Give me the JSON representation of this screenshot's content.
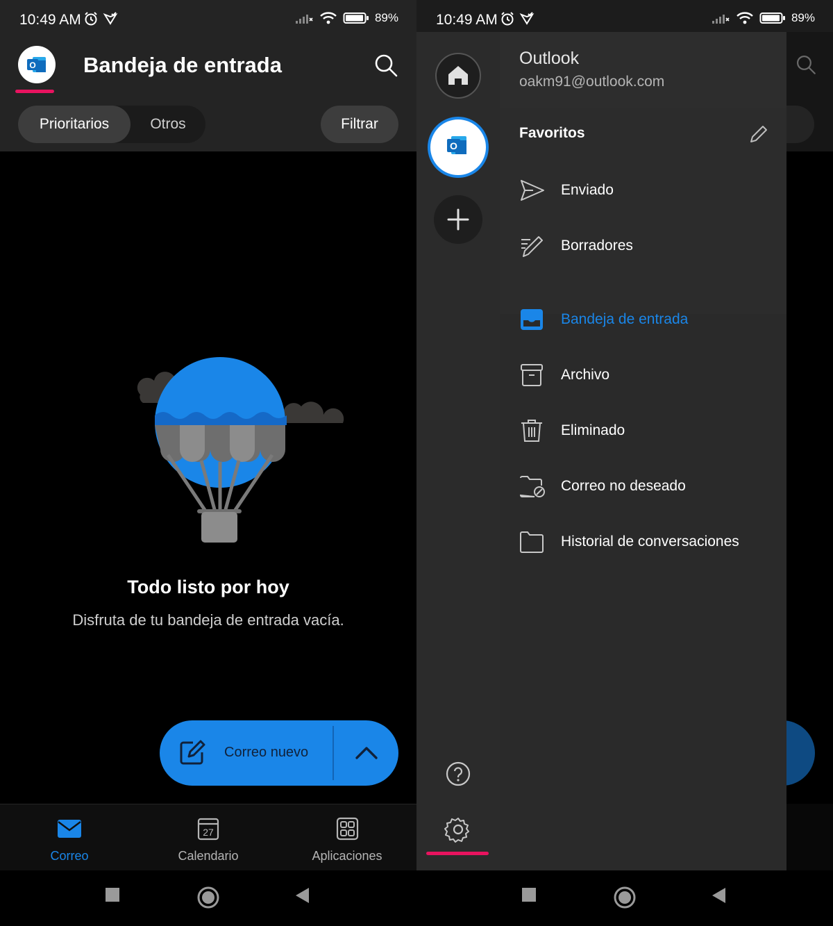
{
  "status": {
    "time": "10:49 AM",
    "battery": "89%"
  },
  "inbox": {
    "title": "Bandeja de entrada",
    "tabs": {
      "focused": "Prioritarios",
      "other": "Otros"
    },
    "filter_label": "Filtrar",
    "empty_title": "Todo listo por hoy",
    "empty_subtitle": "Disfruta de tu bandeja de entrada vacía.",
    "compose_label": "Correo nuevo"
  },
  "bottom_tabs": [
    {
      "label": "Correo",
      "icon": "mail-icon",
      "active": true
    },
    {
      "label": "Calendario",
      "icon": "calendar-icon",
      "day": "27"
    },
    {
      "label": "Aplicaciones",
      "icon": "apps-icon"
    }
  ],
  "drawer": {
    "account_name": "Outlook",
    "account_email": "oakm91@outlook.com",
    "favorites_label": "Favoritos",
    "favorites": [
      {
        "label": "Enviado",
        "icon": "send-icon"
      },
      {
        "label": "Borradores",
        "icon": "draft-icon"
      }
    ],
    "folders": [
      {
        "label": "Bandeja de entrada",
        "icon": "inbox-icon",
        "active": true
      },
      {
        "label": "Archivo",
        "icon": "archive-icon"
      },
      {
        "label": "Eliminado",
        "icon": "trash-icon"
      },
      {
        "label": "Correo no deseado",
        "icon": "junk-folder-icon"
      },
      {
        "label": "Historial de conversaciones",
        "icon": "folder-icon"
      }
    ]
  },
  "colors": {
    "accent": "#1a86e8",
    "underline": "#e8135f",
    "bar": "#242424"
  }
}
